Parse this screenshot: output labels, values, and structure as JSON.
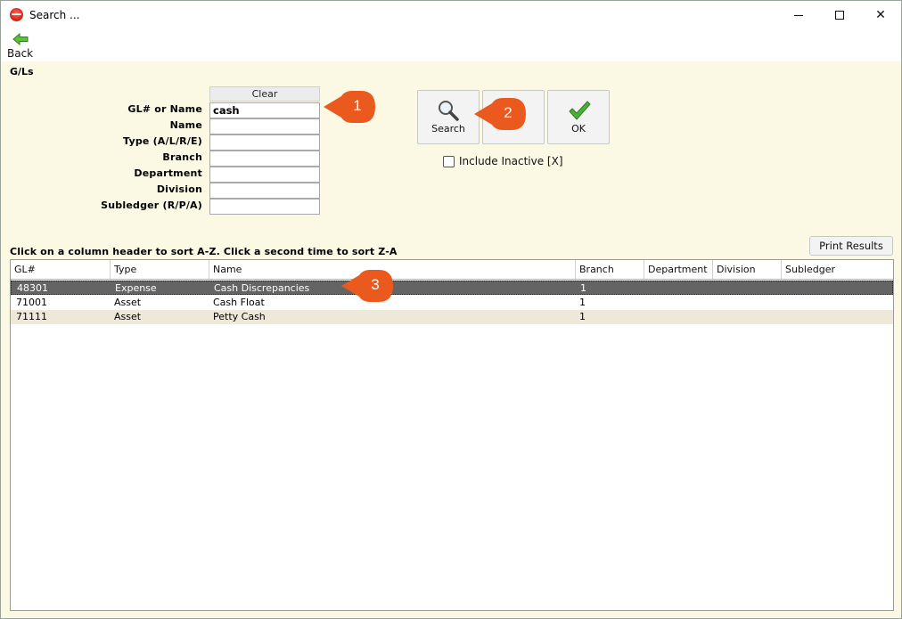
{
  "window": {
    "title": "Search ...",
    "controls": {
      "minimize": "minimize",
      "maximize": "maximize",
      "close": "✕"
    }
  },
  "toolbar": {
    "back_label": "Back"
  },
  "section_title": "G/Ls",
  "form": {
    "clear_label": "Clear",
    "fields": [
      {
        "label": "GL# or Name",
        "value": "cash"
      },
      {
        "label": "Name",
        "value": ""
      },
      {
        "label": "Type (A/L/R/E)",
        "value": ""
      },
      {
        "label": "Branch",
        "value": ""
      },
      {
        "label": "Department",
        "value": ""
      },
      {
        "label": "Division",
        "value": ""
      },
      {
        "label": "Subledger (R/P/A)",
        "value": ""
      }
    ]
  },
  "actions": {
    "search_label": "Search",
    "ok_label": "OK",
    "include_inactive_label": "Include Inactive [X]",
    "include_inactive_checked": false
  },
  "callouts": [
    "1",
    "2",
    "3"
  ],
  "results": {
    "instructions": "Click on a column header to sort A-Z.  Click a second time to sort Z-A",
    "print_label": "Print Results",
    "columns": [
      "GL#",
      "Type",
      "Name",
      "Branch",
      "Department",
      "Division",
      "Subledger"
    ],
    "rows": [
      {
        "gl": "48301",
        "type": "Expense",
        "name": "Cash Discrepancies",
        "branch": "1",
        "department": "",
        "division": "",
        "subledger": ""
      },
      {
        "gl": "71001",
        "type": "Asset",
        "name": "Cash Float",
        "branch": "1",
        "department": "",
        "division": "",
        "subledger": ""
      },
      {
        "gl": "71111",
        "type": "Asset",
        "name": "Petty Cash",
        "branch": "1",
        "department": "",
        "division": "",
        "subledger": ""
      }
    ],
    "selected_row": 0
  },
  "colors": {
    "window_bg": "#fbf8e4",
    "selected_row": "#646464",
    "alt_row": "#ede8d8",
    "callout": "#ea5a1f",
    "ok_check": "#3f9a2e"
  }
}
